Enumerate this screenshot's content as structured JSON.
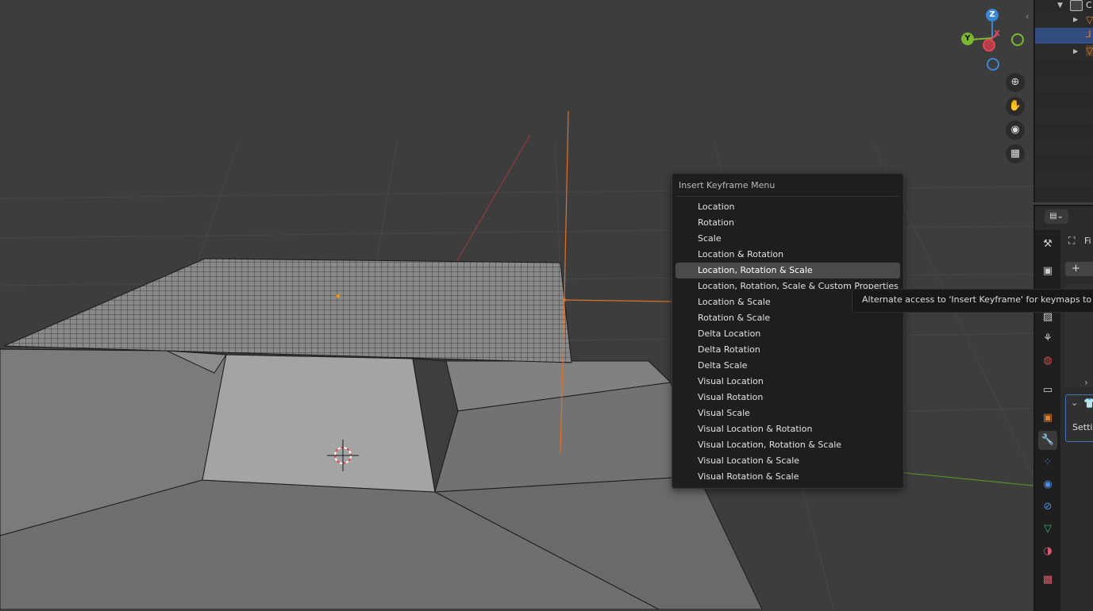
{
  "gizmo": {
    "z_label": "Z",
    "y_label": "Y",
    "x_label": "X",
    "colors": {
      "x": "#e04a5a",
      "y": "#7cb82f",
      "z": "#3b87d6"
    }
  },
  "viewport_nav": {
    "zoom_icon": "zoom-plus-icon",
    "pan_icon": "hand-icon",
    "camera_icon": "camera-icon",
    "ortho_icon": "grid-icon"
  },
  "menu": {
    "title": "Insert Keyframe Menu",
    "items": [
      "Location",
      "Rotation",
      "Scale",
      "Location & Rotation",
      "Location, Rotation & Scale",
      "Location, Rotation, Scale & Custom Properties",
      "Location & Scale",
      "Rotation & Scale",
      "Delta Location",
      "Delta Rotation",
      "Delta Scale",
      "Visual Location",
      "Visual Rotation",
      "Visual Scale",
      "Visual Location & Rotation",
      "Visual Location, Rotation & Scale",
      "Visual Location & Scale",
      "Visual Rotation & Scale"
    ],
    "active_index": 4
  },
  "tooltip": {
    "text": "Alternate access to 'Insert Keyframe' for keymaps to use"
  },
  "outliner": {
    "first_row_label": "C"
  },
  "properties": {
    "fit_label": "Fi",
    "add_label": "+",
    "settings_label": "Settin",
    "accent_color": "#4772b3"
  }
}
